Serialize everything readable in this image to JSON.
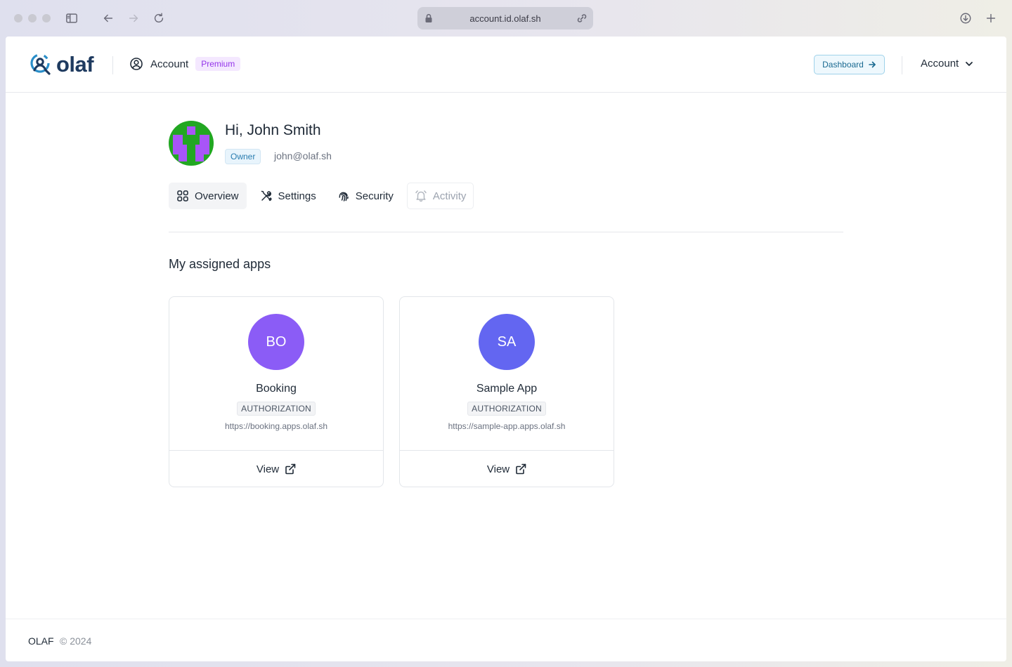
{
  "browser": {
    "url": "account.id.olaf.sh"
  },
  "header": {
    "logo_text": "olaf",
    "section_label": "Account",
    "plan_badge": "Premium",
    "dashboard_button": "Dashboard",
    "account_menu": "Account"
  },
  "profile": {
    "greeting": "Hi, John Smith",
    "role": "Owner",
    "email": "john@olaf.sh"
  },
  "tabs": [
    {
      "label": "Overview",
      "icon": "grid-icon",
      "state": "active"
    },
    {
      "label": "Settings",
      "icon": "tools-icon",
      "state": "normal"
    },
    {
      "label": "Security",
      "icon": "fingerprint-icon",
      "state": "normal"
    },
    {
      "label": "Activity",
      "icon": "bell-icon",
      "state": "disabled"
    }
  ],
  "apps_section": {
    "title": "My assigned apps",
    "apps": [
      {
        "initials": "BO",
        "name": "Booking",
        "type": "AUTHORIZATION",
        "url": "https://booking.apps.olaf.sh",
        "view_label": "View",
        "color": "#8b5cf6"
      },
      {
        "initials": "SA",
        "name": "Sample App",
        "type": "AUTHORIZATION",
        "url": "https://sample-app.apps.olaf.sh",
        "view_label": "View",
        "color": "#6366f1"
      }
    ]
  },
  "footer": {
    "brand": "OLAF",
    "copyright": "© 2024"
  },
  "colors": {
    "brand_navy": "#1e3a5f",
    "brand_blue": "#2a8ec9",
    "premium_purple": "#9333ea",
    "avatar_green": "#22a722",
    "avatar_purple": "#a855f7"
  }
}
